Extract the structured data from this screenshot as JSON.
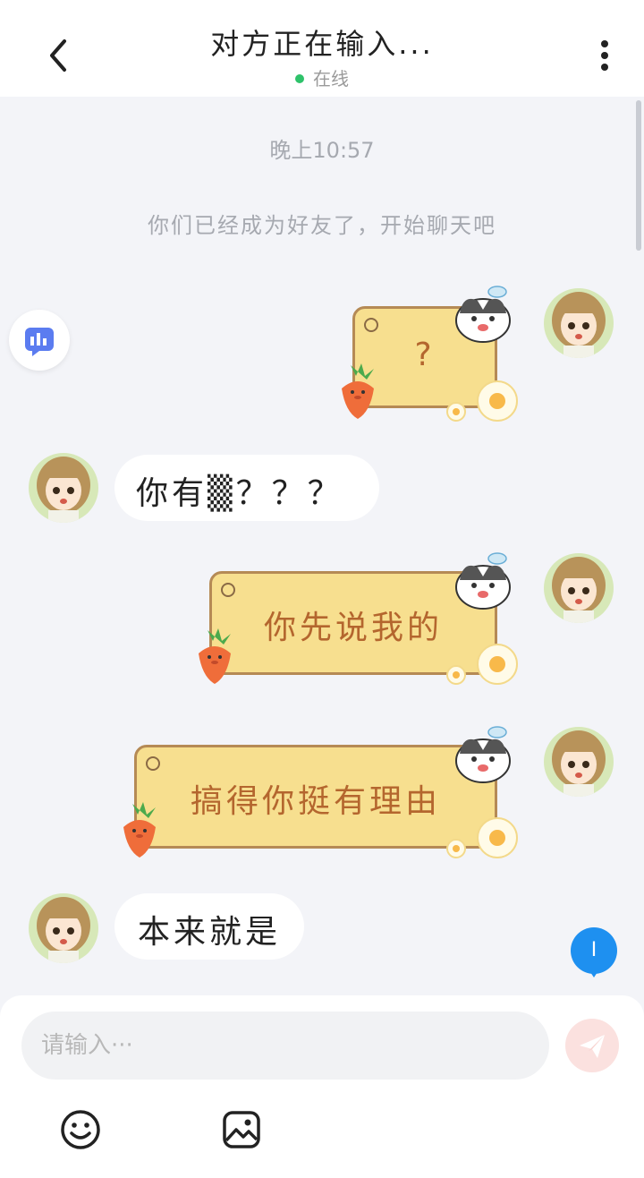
{
  "header": {
    "title": "对方正在输入...",
    "status": "在线",
    "status_color": "#2ec26a"
  },
  "chat": {
    "time_label": "晚上10:57",
    "system_message": "你们已经成为好友了，开始聊天吧",
    "messages": [
      {
        "side": "right",
        "type": "sticker",
        "text": "?"
      },
      {
        "side": "left",
        "type": "text",
        "text": "你有▒？？？"
      },
      {
        "side": "right",
        "type": "sticker",
        "text": "你先说我的"
      },
      {
        "side": "right",
        "type": "sticker",
        "text": "搞得你挺有理由"
      },
      {
        "side": "left",
        "type": "text",
        "text": "本来就是"
      }
    ],
    "unread_badge": "I"
  },
  "input": {
    "placeholder": "请输入···"
  },
  "icons": {
    "back": "chevron-left-icon",
    "more": "more-vertical-icon",
    "stats": "bar-chart-icon",
    "send": "send-icon",
    "emoji": "emoji-icon",
    "image": "image-icon"
  }
}
